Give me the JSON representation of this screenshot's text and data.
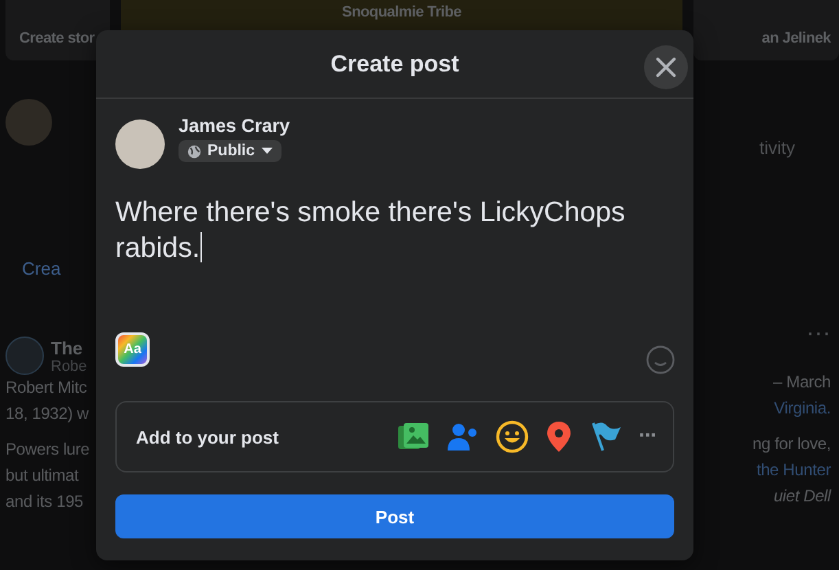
{
  "background": {
    "stories": [
      {
        "label": "Create stor"
      },
      {
        "label": "Snoqualmie Tribe"
      },
      {
        "label": "an Jelinek"
      }
    ],
    "left": [
      {
        "kind": "composer"
      },
      {
        "kind": "action",
        "text": "Crea"
      },
      {
        "kind": "post_head",
        "title": "The",
        "subtitle": "Robe"
      },
      {
        "kind": "line",
        "text": "Robert Mitc"
      },
      {
        "kind": "line",
        "text": "18, 1932) w"
      },
      {
        "kind": "gap"
      },
      {
        "kind": "line",
        "text": "Powers lure"
      },
      {
        "kind": "line",
        "text": "but ultimat"
      },
      {
        "kind": "line",
        "text": "and its 195"
      }
    ],
    "right": [
      {
        "kind": "action",
        "text": "tivity"
      },
      {
        "kind": "more",
        "text": "···"
      },
      {
        "kind": "line",
        "text": "– March"
      },
      {
        "kind": "link",
        "text": "Virginia."
      },
      {
        "kind": "gap"
      },
      {
        "kind": "line",
        "text": "ng for love,"
      },
      {
        "kind": "link",
        "text": "the Hunter"
      },
      {
        "kind": "italic",
        "text": "uiet Dell"
      }
    ]
  },
  "dialog": {
    "title": "Create post",
    "author": {
      "name": "James Crary",
      "audience": "Public"
    },
    "text": "Where there's smoke there's LickyChops rabids.",
    "text_style_button": "Aa",
    "add_to_post": {
      "label": "Add to your post",
      "more": "···"
    },
    "post_button": "Post"
  }
}
